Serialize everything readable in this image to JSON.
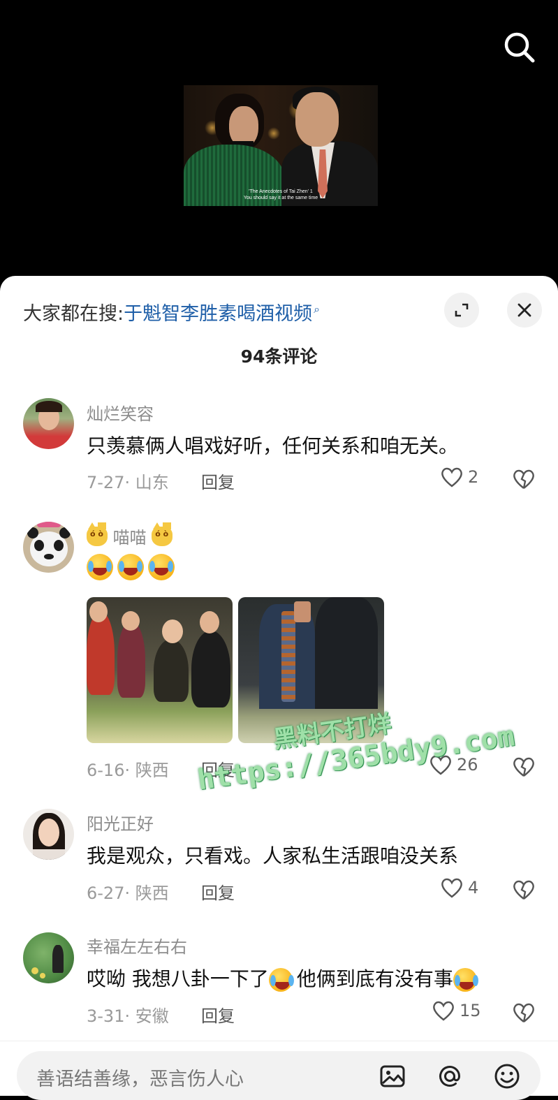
{
  "video": {
    "subtitle_line1": "'The Anecdotes of Tai Zhen' 1",
    "subtitle_line2": "You should say it at the same time"
  },
  "comments_panel": {
    "trending_label": "大家都在搜:",
    "trending_keyword": "于魁智李胜素喝酒视频",
    "count_title": "94条评论",
    "comments": [
      {
        "username": "灿烂笑容",
        "text": "只羡慕俩人唱戏好听，任何关系和咱无关。",
        "date_location": "7-27· 山东",
        "reply_label": "回复",
        "likes": "2"
      },
      {
        "username": "喵喵",
        "date_location": "6-16· 陕西",
        "reply_label": "回复",
        "likes": "26"
      },
      {
        "username": "阳光正好",
        "text": "我是观众，只看戏。人家私生活跟咱没关系",
        "date_location": "6-27· 陕西",
        "reply_label": "回复",
        "likes": "4"
      },
      {
        "username": "幸福左左右右",
        "text_part1": "哎呦  我想八卦一下了",
        "text_part2": "他俩到底有没有事",
        "date_location": "3-31· 安徽",
        "reply_label": "回复",
        "likes": "15"
      }
    ]
  },
  "watermark": {
    "line1": "黑料不打烊",
    "line2": "https://365bdy9.com"
  },
  "input_bar": {
    "placeholder": "善语结善缘，恶言伤人心"
  },
  "icons": {
    "search": "search-icon",
    "expand": "expand-icon",
    "close": "close-icon",
    "heart": "heart-icon",
    "broken_heart": "broken-heart-icon",
    "image": "image-icon",
    "mention": "at-icon",
    "emoji": "emoji-icon"
  }
}
